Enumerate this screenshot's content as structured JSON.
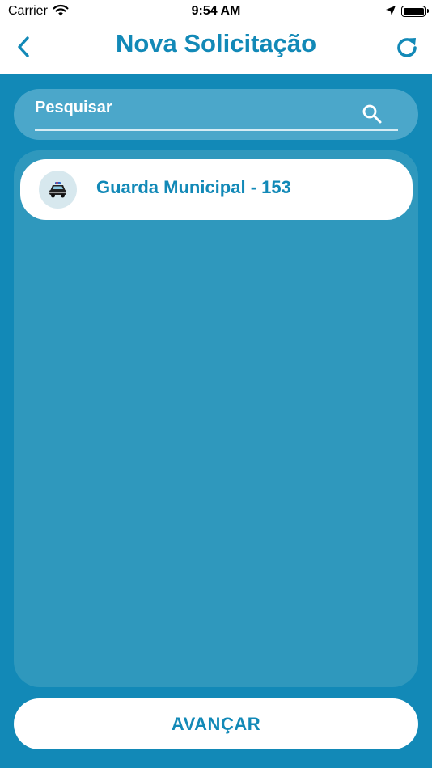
{
  "status_bar": {
    "carrier": "Carrier",
    "time": "9:54 AM",
    "icons": [
      "wifi-icon",
      "location-arrow-icon",
      "battery-icon"
    ]
  },
  "nav": {
    "title": "Nova Solicitação",
    "back_icon": "chevron-left-icon",
    "refresh_icon": "refresh-icon"
  },
  "search": {
    "placeholder": "Pesquisar",
    "value": "",
    "icon": "search-icon"
  },
  "list": {
    "items": [
      {
        "label": "Guarda Municipal - 153",
        "icon": "police-car-icon"
      }
    ]
  },
  "footer": {
    "advance_label": "AVANÇAR"
  },
  "colors": {
    "primary": "#1289b7",
    "search_bg": "#4ba7ca",
    "panel_bg": "#2f98bd",
    "avatar_bg": "#d7e8ee",
    "white": "#ffffff"
  }
}
